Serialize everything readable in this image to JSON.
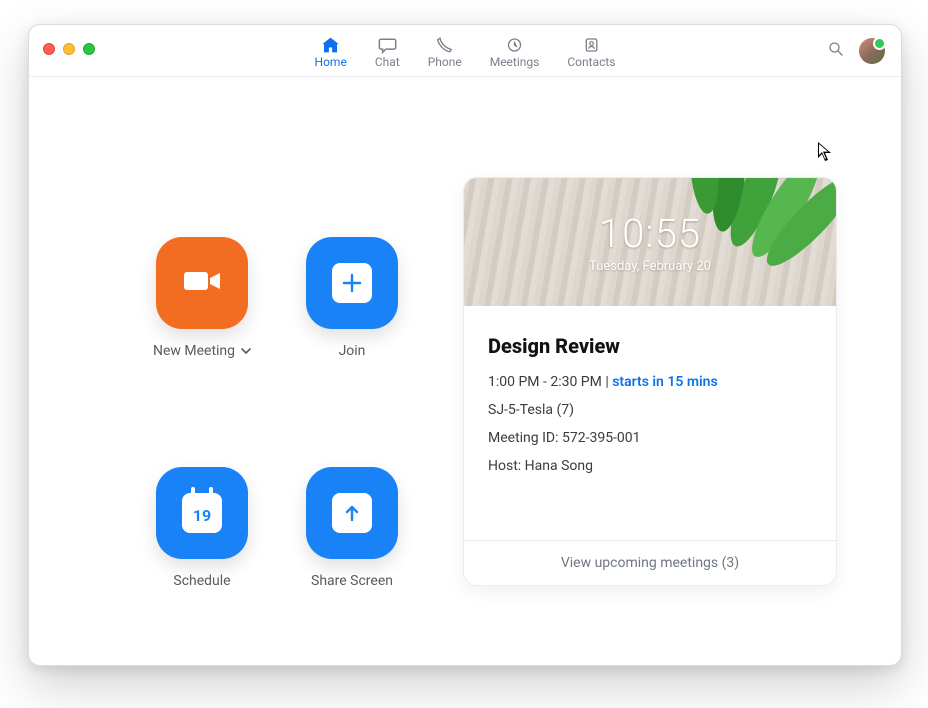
{
  "nav": {
    "items": [
      {
        "label": "Home",
        "active": true
      },
      {
        "label": "Chat"
      },
      {
        "label": "Phone"
      },
      {
        "label": "Meetings"
      },
      {
        "label": "Contacts"
      }
    ]
  },
  "actions": {
    "new_meeting": {
      "label": "New Meeting"
    },
    "join": {
      "label": "Join"
    },
    "schedule": {
      "label": "Schedule",
      "day": "19"
    },
    "share": {
      "label": "Share Screen"
    }
  },
  "clock": {
    "time": "10:55",
    "date": "Tuesday, February 20"
  },
  "meeting": {
    "title": "Design Review",
    "time_range": "1:00 PM - 2:30 PM",
    "separator": "  |  ",
    "starts_in": "starts in 15 mins",
    "room": "SJ-5-Tesla (7)",
    "id_label": "Meeting ID: 572-395-001",
    "host": "Host: Hana Song"
  },
  "upcoming": {
    "label": "View upcoming meetings (3)"
  }
}
